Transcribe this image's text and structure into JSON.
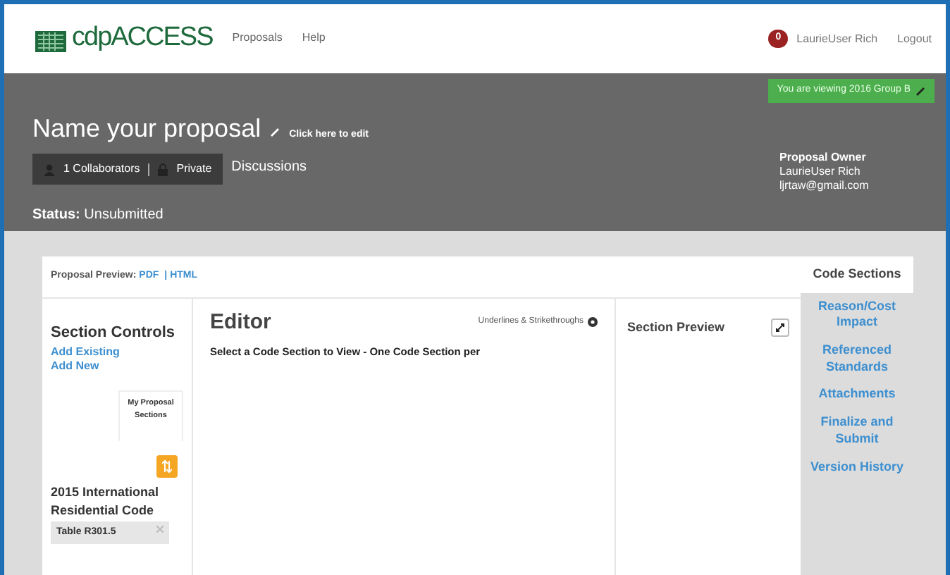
{
  "header": {
    "logo": "cdpACCESS",
    "nav": [
      {
        "label": "Proposals"
      },
      {
        "label": "Help"
      }
    ],
    "notification_count": "0",
    "user": "LaurieUser Rich",
    "logout": "Logout"
  },
  "banner": {
    "viewing_notice": "You are viewing 2016 Group B",
    "title": "Name your proposal",
    "edit_hint": "Click here to edit",
    "collaborators": "1 Collaborators",
    "privacy": "Private",
    "discussions": "Discussions",
    "status_label": "Status:",
    "status_value": "Unsubmitted",
    "owner_heading": "Proposal Owner",
    "owner_name": "LaurieUser Rich",
    "owner_email": "ljrtaw@gmail.com"
  },
  "preview": {
    "label": "Proposal Preview:",
    "links": [
      "PDF",
      "HTML"
    ],
    "separator": "|"
  },
  "section_controls": {
    "heading": "Section Controls",
    "links": [
      "Add Existing",
      "Add New"
    ],
    "tab": "My Proposal Sections",
    "code_book": "2015 International Residential Code",
    "section_item": "Table R301.5"
  },
  "editor": {
    "heading": "Editor",
    "toggle": "Underlines & Strikethroughs",
    "instruction": "Select a Code Section to View - One Code Section per"
  },
  "section_preview": {
    "heading": "Section Preview"
  },
  "side_tabs": [
    {
      "label": "Code Sections",
      "selected": true
    },
    {
      "label": "Reason/Cost Impact",
      "selected": false
    },
    {
      "label": "Referenced Standards",
      "selected": false
    },
    {
      "label": "Attachments",
      "selected": false
    },
    {
      "label": "Finalize and Submit",
      "selected": false
    },
    {
      "label": "Version History",
      "selected": false
    }
  ]
}
